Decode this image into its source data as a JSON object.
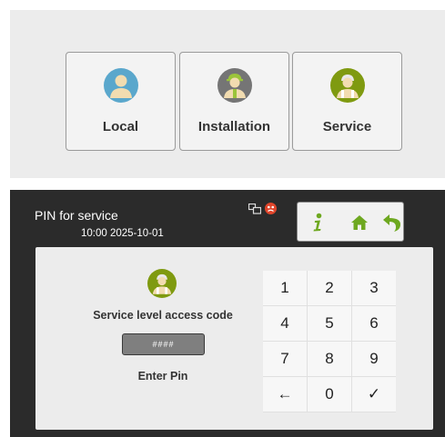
{
  "role_screen": {
    "cards": [
      {
        "label": "Local",
        "icon": "user-icon",
        "color": "#5aa7cc"
      },
      {
        "label": "Installation",
        "icon": "installer-icon",
        "color": "#757575"
      },
      {
        "label": "Service",
        "icon": "service-technician-icon",
        "color": "#7f9a10"
      }
    ]
  },
  "pin_screen": {
    "title": "PIN for service",
    "datetime": "10:00  2025-10-01",
    "status_icons": [
      "network-icon",
      "alert-icon"
    ],
    "toolbar": {
      "info": "info-icon",
      "home": "home-icon",
      "back": "back-arrow-icon",
      "accent": "#6ea820"
    },
    "access_label": "Service level access code",
    "pin_value": "####",
    "enter_label": "Enter Pin",
    "keypad": [
      "1",
      "2",
      "3",
      "4",
      "5",
      "6",
      "7",
      "8",
      "9",
      "←",
      "0",
      "✓"
    ]
  }
}
